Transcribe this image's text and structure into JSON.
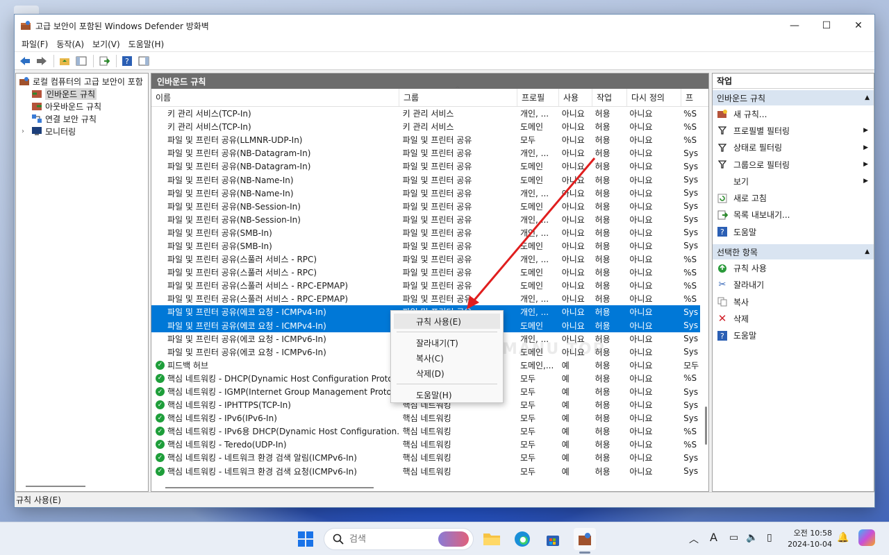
{
  "window": {
    "title": "고급 보안이 포함된 Windows Defender 방화벽"
  },
  "menu": [
    "파일(F)",
    "동작(A)",
    "보기(V)",
    "도움말(H)"
  ],
  "tree": {
    "root": "로컬 컴퓨터의 고급 보안이 포함",
    "items": [
      "인바운드 규칙",
      "아웃바운드 규칙",
      "연결 보안 규칙",
      "모니터링"
    ]
  },
  "center": {
    "header": "인바운드 규칙",
    "columns": [
      "이름",
      "그룹",
      "프로필",
      "사용",
      "작업",
      "다시 정의",
      "프"
    ],
    "rows": [
      {
        "name": "키 관리 서비스(TCP-In)",
        "group": "키 관리 서비스",
        "profile": "개인, ...",
        "enabled": "아니요",
        "action": "허용",
        "override": "아니요",
        "prog": "%S",
        "check": false,
        "selected": false
      },
      {
        "name": "키 관리 서비스(TCP-In)",
        "group": "키 관리 서비스",
        "profile": "도메인",
        "enabled": "아니요",
        "action": "허용",
        "override": "아니요",
        "prog": "%S",
        "check": false,
        "selected": false
      },
      {
        "name": "파일 및 프린터 공유(LLMNR-UDP-In)",
        "group": "파일 및 프린터 공유",
        "profile": "모두",
        "enabled": "아니요",
        "action": "허용",
        "override": "아니요",
        "prog": "%S",
        "check": false,
        "selected": false
      },
      {
        "name": "파일 및 프린터 공유(NB-Datagram-In)",
        "group": "파일 및 프린터 공유",
        "profile": "개인, ...",
        "enabled": "아니요",
        "action": "허용",
        "override": "아니요",
        "prog": "Sys",
        "check": false,
        "selected": false
      },
      {
        "name": "파일 및 프린터 공유(NB-Datagram-In)",
        "group": "파일 및 프린터 공유",
        "profile": "도메인",
        "enabled": "아니요",
        "action": "허용",
        "override": "아니요",
        "prog": "Sys",
        "check": false,
        "selected": false
      },
      {
        "name": "파일 및 프린터 공유(NB-Name-In)",
        "group": "파일 및 프린터 공유",
        "profile": "도메인",
        "enabled": "아니요",
        "action": "허용",
        "override": "아니요",
        "prog": "Sys",
        "check": false,
        "selected": false
      },
      {
        "name": "파일 및 프린터 공유(NB-Name-In)",
        "group": "파일 및 프린터 공유",
        "profile": "개인, ...",
        "enabled": "아니요",
        "action": "허용",
        "override": "아니요",
        "prog": "Sys",
        "check": false,
        "selected": false
      },
      {
        "name": "파일 및 프린터 공유(NB-Session-In)",
        "group": "파일 및 프린터 공유",
        "profile": "도메인",
        "enabled": "아니요",
        "action": "허용",
        "override": "아니요",
        "prog": "Sys",
        "check": false,
        "selected": false
      },
      {
        "name": "파일 및 프린터 공유(NB-Session-In)",
        "group": "파일 및 프린터 공유",
        "profile": "개인, ...",
        "enabled": "아니요",
        "action": "허용",
        "override": "아니요",
        "prog": "Sys",
        "check": false,
        "selected": false
      },
      {
        "name": "파일 및 프린터 공유(SMB-In)",
        "group": "파일 및 프린터 공유",
        "profile": "개인, ...",
        "enabled": "아니요",
        "action": "허용",
        "override": "아니요",
        "prog": "Sys",
        "check": false,
        "selected": false
      },
      {
        "name": "파일 및 프린터 공유(SMB-In)",
        "group": "파일 및 프린터 공유",
        "profile": "도메인",
        "enabled": "아니요",
        "action": "허용",
        "override": "아니요",
        "prog": "Sys",
        "check": false,
        "selected": false
      },
      {
        "name": "파일 및 프린터 공유(스풀러 서비스 - RPC)",
        "group": "파일 및 프린터 공유",
        "profile": "개인, ...",
        "enabled": "아니요",
        "action": "허용",
        "override": "아니요",
        "prog": "%S",
        "check": false,
        "selected": false
      },
      {
        "name": "파일 및 프린터 공유(스풀러 서비스 - RPC)",
        "group": "파일 및 프린터 공유",
        "profile": "도메인",
        "enabled": "아니요",
        "action": "허용",
        "override": "아니요",
        "prog": "%S",
        "check": false,
        "selected": false
      },
      {
        "name": "파일 및 프린터 공유(스풀러 서비스 - RPC-EPMAP)",
        "group": "파일 및 프린터 공유",
        "profile": "도메인",
        "enabled": "아니요",
        "action": "허용",
        "override": "아니요",
        "prog": "%S",
        "check": false,
        "selected": false
      },
      {
        "name": "파일 및 프린터 공유(스풀러 서비스 - RPC-EPMAP)",
        "group": "파일 및 프린터 공유",
        "profile": "개인, ...",
        "enabled": "아니요",
        "action": "허용",
        "override": "아니요",
        "prog": "%S",
        "check": false,
        "selected": false
      },
      {
        "name": "파일 및 프린터 공유(에코 요청 - ICMPv4-In)",
        "group": "파일 및 프린터 공유",
        "profile": "개인, ...",
        "enabled": "아니요",
        "action": "허용",
        "override": "아니요",
        "prog": "Sys",
        "check": false,
        "selected": true
      },
      {
        "name": "파일 및 프린터 공유(에코 요청 - ICMPv4-In)",
        "group": "",
        "profile": "도메인",
        "enabled": "아니요",
        "action": "허용",
        "override": "아니요",
        "prog": "Sys",
        "check": false,
        "selected": true
      },
      {
        "name": "파일 및 프린터 공유(에코 요청 - ICMPv6-In)",
        "group": "",
        "profile": "개인, ...",
        "enabled": "아니요",
        "action": "허용",
        "override": "아니요",
        "prog": "Sys",
        "check": false,
        "selected": false
      },
      {
        "name": "파일 및 프린터 공유(에코 요청 - ICMPv6-In)",
        "group": "",
        "profile": "도메인",
        "enabled": "아니요",
        "action": "허용",
        "override": "아니요",
        "prog": "Sys",
        "check": false,
        "selected": false
      },
      {
        "name": "피드백 허브",
        "group": "",
        "profile": "도메인,...",
        "enabled": "예",
        "action": "허용",
        "override": "아니요",
        "prog": "모두",
        "check": true,
        "selected": false
      },
      {
        "name": "핵심 네트워킹 - DHCP(Dynamic Host Configuration Protocol",
        "group": "",
        "profile": "모두",
        "enabled": "예",
        "action": "허용",
        "override": "아니요",
        "prog": "%S",
        "check": true,
        "selected": false
      },
      {
        "name": "핵심 네트워킹 - IGMP(Internet Group Management Protocol",
        "group": "",
        "profile": "모두",
        "enabled": "예",
        "action": "허용",
        "override": "아니요",
        "prog": "Sys",
        "check": true,
        "selected": false
      },
      {
        "name": "핵심 네트워킹 - IPHTTPS(TCP-In)",
        "group": "핵심 네트워킹",
        "profile": "모두",
        "enabled": "예",
        "action": "허용",
        "override": "아니요",
        "prog": "Sys",
        "check": true,
        "selected": false
      },
      {
        "name": "핵심 네트워킹 - IPv6(IPv6-In)",
        "group": "핵심 네트워킹",
        "profile": "모두",
        "enabled": "예",
        "action": "허용",
        "override": "아니요",
        "prog": "Sys",
        "check": true,
        "selected": false
      },
      {
        "name": "핵심 네트워킹 - IPv6용 DHCP(Dynamic Host Configuration...",
        "group": "핵심 네트워킹",
        "profile": "모두",
        "enabled": "예",
        "action": "허용",
        "override": "아니요",
        "prog": "%S",
        "check": true,
        "selected": false
      },
      {
        "name": "핵심 네트워킹 - Teredo(UDP-In)",
        "group": "핵심 네트워킹",
        "profile": "모두",
        "enabled": "예",
        "action": "허용",
        "override": "아니요",
        "prog": "%S",
        "check": true,
        "selected": false
      },
      {
        "name": "핵심 네트워킹 - 네트워크 환경 검색 알림(ICMPv6-In)",
        "group": "핵심 네트워킹",
        "profile": "모두",
        "enabled": "예",
        "action": "허용",
        "override": "아니요",
        "prog": "Sys",
        "check": true,
        "selected": false
      },
      {
        "name": "핵심 네트워킹 - 네트워크 환경 검색 요청(ICMPv6-In)",
        "group": "핵심 네트워킹",
        "profile": "모두",
        "enabled": "예",
        "action": "허용",
        "override": "아니요",
        "prog": "Sys",
        "check": true,
        "selected": false
      }
    ]
  },
  "context_menu": {
    "items": [
      "규칙 사용(E)",
      "잘라내기(T)",
      "복사(C)",
      "삭제(D)",
      "도움말(H)"
    ]
  },
  "actions": {
    "title": "작업",
    "section1": "인바운드 규칙",
    "section1_items": [
      "새 규칙...",
      "프로필별 필터링",
      "상태로 필터링",
      "그룹으로 필터링",
      "보기",
      "새로 고침",
      "목록 내보내기...",
      "도움말"
    ],
    "section2": "선택한 항목",
    "section2_items": [
      "규칙 사용",
      "잘라내기",
      "복사",
      "삭제",
      "도움말"
    ]
  },
  "status": "규칙 사용(E)",
  "taskbar": {
    "search_placeholder": "검색",
    "time": "오전 10:58",
    "date": "2024-10-04",
    "ime": "A"
  },
  "watermark": "MANU           TOP"
}
